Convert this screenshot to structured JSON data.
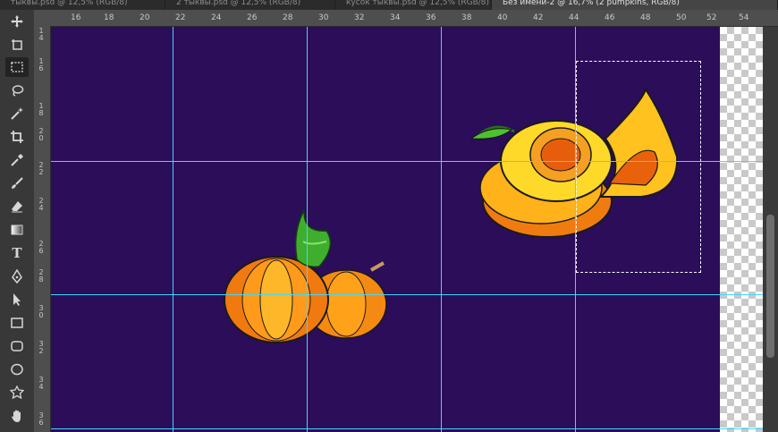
{
  "tabs": [
    {
      "label": "тыквы.psd @ 12,5% (RGB/8)"
    },
    {
      "label": "2 тыквы.psd @ 12,5% (RGB/8)"
    },
    {
      "label": "кусок тыквы.psd @ 12,5% (RGB/8)"
    },
    {
      "label": "Без имени-2 @ 16,7% (2 pumpkins, RGB/8)"
    }
  ],
  "ruler_top": [
    "16",
    "18",
    "20",
    "22",
    "24",
    "26",
    "28",
    "30",
    "32",
    "34",
    "36",
    "38",
    "40",
    "42",
    "44",
    "46",
    "48",
    "50",
    "52",
    "54"
  ],
  "ruler_left": [
    "1\n4",
    "1\n6",
    "1\n8",
    "2\n0",
    "2\n2",
    "2\n4",
    "2\n6",
    "2\n8",
    "3\n0",
    "3\n2",
    "3\n4",
    "3\n6"
  ],
  "tools": [
    {
      "name": "move-tool",
      "icon": "move-icon"
    },
    {
      "name": "artboard-tool",
      "icon": "artboard-icon"
    },
    {
      "name": "marquee-tool",
      "icon": "rect-marquee-icon",
      "active": true
    },
    {
      "name": "lasso-tool",
      "icon": "lasso-icon"
    },
    {
      "name": "magic-wand-tool",
      "icon": "magic-wand-icon"
    },
    {
      "name": "crop-tool",
      "icon": "crop-icon"
    },
    {
      "name": "eyedropper-tool",
      "icon": "eyedropper-icon"
    },
    {
      "name": "brush-tool",
      "icon": "brush-icon"
    },
    {
      "name": "eraser-tool",
      "icon": "eraser-icon"
    },
    {
      "name": "gradient-tool",
      "icon": "gradient-icon"
    },
    {
      "name": "type-tool",
      "icon": "type-icon",
      "glyph": "T"
    },
    {
      "name": "pen-tool",
      "icon": "pen-icon"
    },
    {
      "name": "path-selection-tool",
      "icon": "arrow-icon"
    },
    {
      "name": "rectangle-tool",
      "icon": "rectangle-icon"
    },
    {
      "name": "rounded-rect-tool",
      "icon": "rounded-rect-icon"
    },
    {
      "name": "ellipse-tool",
      "icon": "ellipse-icon"
    },
    {
      "name": "custom-shape-tool",
      "icon": "puzzle-icon"
    },
    {
      "name": "hand-tool",
      "icon": "hand-icon"
    }
  ],
  "colors": {
    "canvas_background": "#2b0d5a",
    "guide": "#3fd8ff",
    "pumpkin_orange": "#f08a12",
    "pumpkin_yellow": "#ffd21a",
    "stem_green": "#3fae2e"
  }
}
